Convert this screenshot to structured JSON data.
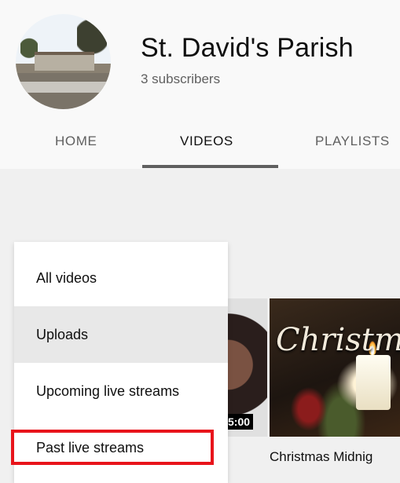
{
  "channel": {
    "name": "St. David's Parish",
    "subscribers": "3 subscribers"
  },
  "tabs": [
    {
      "label": "HOME"
    },
    {
      "label": "VIDEOS",
      "active": true
    },
    {
      "label": "PLAYLISTS"
    }
  ],
  "menu": {
    "items": [
      {
        "label": "All videos"
      },
      {
        "label": "Uploads",
        "selected": true
      },
      {
        "label": "Upcoming live streams"
      },
      {
        "label": "Past live streams",
        "highlighted": true
      }
    ]
  },
  "videos": [
    {
      "duration": "5:00"
    },
    {
      "thumbnail_text": "Christmas",
      "title": "Christmas Midnig"
    }
  ],
  "colors": {
    "highlight": "#e8141b",
    "tab_underline": "#606060"
  }
}
